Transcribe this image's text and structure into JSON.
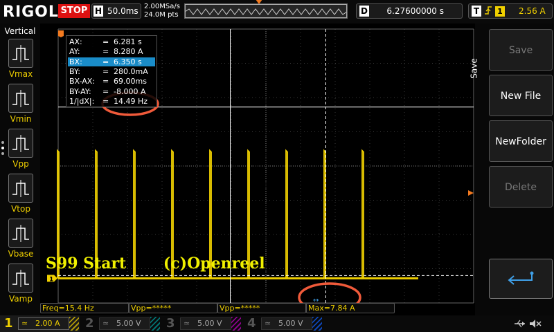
{
  "brand": "RIGOL",
  "run_state": "STOP",
  "timebase": {
    "letter": "H",
    "value": "50.0ms"
  },
  "acquisition": {
    "sample_rate": "2.00MSa/s",
    "points": "24.0M pts"
  },
  "delay": {
    "letter": "D",
    "value": "6.27600000 s"
  },
  "trigger": {
    "letter": "T",
    "edge_icon": "rising-edge-icon",
    "source": "1",
    "level": "2.56 A"
  },
  "left_menu": {
    "title": "Vertical",
    "items": [
      {
        "label": "Vmax",
        "icon": "vmax-icon"
      },
      {
        "label": "Vmin",
        "icon": "vmin-icon"
      },
      {
        "label": "Vpp",
        "icon": "vpp-icon"
      },
      {
        "label": "Vtop",
        "icon": "vtop-icon"
      },
      {
        "label": "Vbase",
        "icon": "vbase-icon"
      },
      {
        "label": "Vamp",
        "icon": "vamp-icon"
      }
    ]
  },
  "cursor_readout": [
    {
      "key": "AX:",
      "eq": "=",
      "value": "6.281 s"
    },
    {
      "key": "AY:",
      "eq": "=",
      "value": "8.280 A"
    },
    {
      "key": "BX:",
      "eq": "=",
      "value": "6.350 s"
    },
    {
      "key": "BY:",
      "eq": "=",
      "value": "280.0mA"
    },
    {
      "key": "BX-AX:",
      "eq": "=",
      "value": "69.00ms"
    },
    {
      "key": "BY-AY:",
      "eq": "=",
      "value": "-8.000 A"
    },
    {
      "key": "1/|dX|:",
      "eq": "=",
      "value": "14.49 Hz"
    }
  ],
  "overlay_text": {
    "title": "S99 Start",
    "credit": "(c)Openreel"
  },
  "channel1_marker": "1",
  "waveform": {
    "pulse_positions_div": [
      0.78,
      1.88,
      2.98,
      4.08,
      5.18,
      6.28,
      7.38,
      8.48,
      9.58
    ],
    "end_div": 9.6,
    "pulse_level_div": 3.55,
    "base_level_div": 7.28,
    "cursor_a_x_div": 5.05,
    "cursor_b_x_div": 6.25,
    "cursor_a_y_div": 1.55,
    "cursor_b_y_div": 7.28
  },
  "save_menu": {
    "title": "Save",
    "keys": [
      {
        "label": "Save",
        "enabled": false
      },
      {
        "label": "New File",
        "enabled": true
      },
      {
        "label": "NewFolder",
        "enabled": true
      },
      {
        "label": "Delete",
        "enabled": false
      }
    ],
    "return_icon": "return-arrow-icon"
  },
  "measurements": [
    {
      "text": "Freq=15.4 Hz"
    },
    {
      "text": "Vpp=*****"
    },
    {
      "text": "Vpp=*****"
    },
    {
      "text": "Max=7.84 A"
    }
  ],
  "channels": [
    {
      "num": "1",
      "coupling": "≃",
      "scale": "2.00 A",
      "color": "#f0d000",
      "active": true
    },
    {
      "num": "2",
      "coupling": "≃",
      "scale": "5.00 V",
      "color": "#00a0a0",
      "active": false
    },
    {
      "num": "3",
      "coupling": "≃",
      "scale": "5.00 V",
      "color": "#c000c0",
      "active": false
    },
    {
      "num": "4",
      "coupling": "≃",
      "scale": "5.00 V",
      "color": "#1060ff",
      "active": false
    }
  ],
  "colors": {
    "ch1": "#f0d000",
    "cursor": "#ffffff",
    "trigger": "#f37a1f",
    "highlight": "#1a8cc8",
    "stop": "#d11111",
    "annotation": "#f05a3a"
  }
}
